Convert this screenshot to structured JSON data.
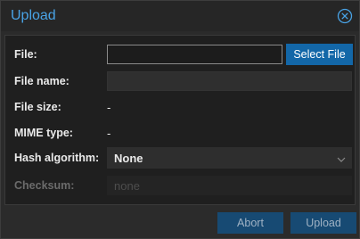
{
  "dialog": {
    "title": "Upload",
    "close_icon": "circle-x-icon"
  },
  "form": {
    "file_label": "File:",
    "file_value": "",
    "select_file_label": "Select File",
    "file_name_label": "File name:",
    "file_name_value": "",
    "file_size_label": "File size:",
    "file_size_value": "-",
    "mime_type_label": "MIME type:",
    "mime_type_value": "-",
    "hash_label": "Hash algorithm:",
    "hash_value": "None",
    "checksum_label": "Checksum:",
    "checksum_placeholder": "none"
  },
  "footer": {
    "abort_label": "Abort",
    "upload_label": "Upload"
  },
  "colors": {
    "accent": "#49a3e6",
    "primary_button": "#1367a8",
    "disabled_button": "#174a73"
  }
}
